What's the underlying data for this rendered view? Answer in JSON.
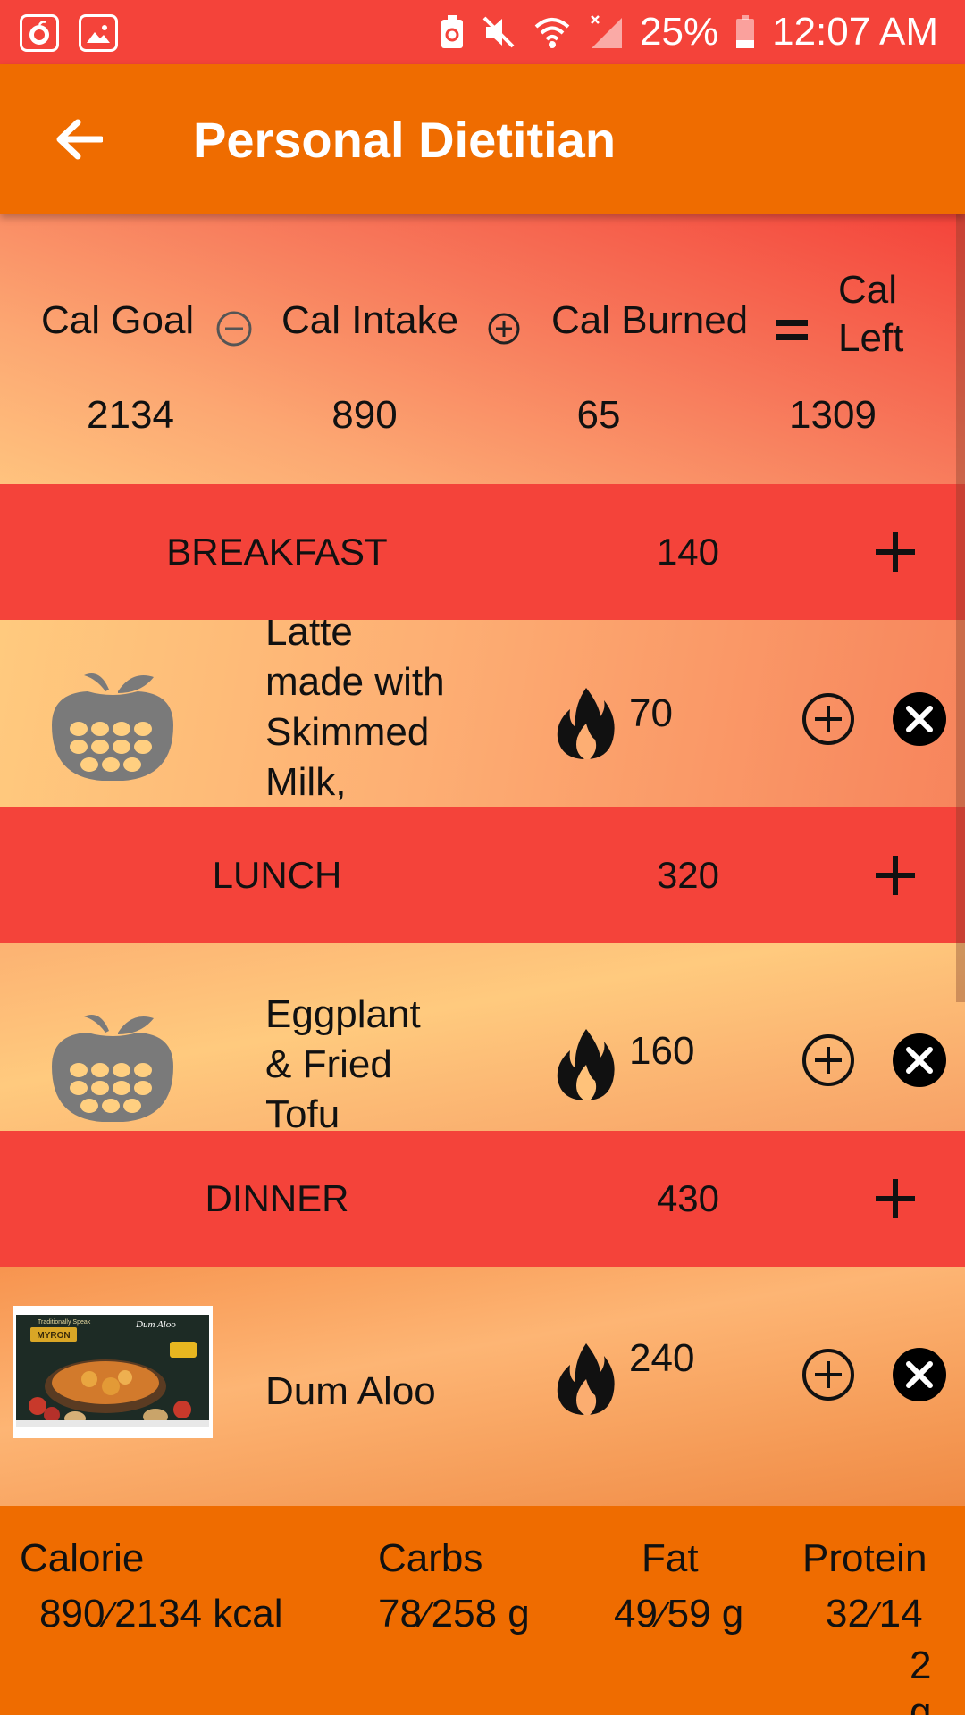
{
  "status_bar": {
    "battery_percent": "25%",
    "time": "12:07 AM",
    "icons": [
      "app-icon",
      "gallery-icon",
      "battery-saver-icon",
      "mute-icon",
      "wifi-icon",
      "signal-icon",
      "battery-icon"
    ]
  },
  "toolbar": {
    "title": "Personal Dietitian",
    "back_icon": "arrow-back-icon"
  },
  "summary": {
    "cal_goal_label": "Cal Goal",
    "cal_intake_label": "Cal Intake",
    "cal_burned_label": "Cal Burned",
    "cal_left_label_line1": "Cal",
    "cal_left_label_line2": "Left",
    "cal_goal": "2134",
    "cal_intake": "890",
    "cal_burned": "65",
    "cal_left": "1309"
  },
  "meals": [
    {
      "name": "BREAKFAST",
      "calories": "140",
      "items": [
        {
          "name_lines": [
            "Latte",
            "made with",
            "Skimmed",
            "Milk,"
          ],
          "calories": "70",
          "image": "calculator-apple-icon"
        }
      ]
    },
    {
      "name": "LUNCH",
      "calories": "320",
      "items": [
        {
          "name_lines": [
            "Eggplant",
            "& Fried",
            "Tofu"
          ],
          "calories": "160",
          "image": "calculator-apple-icon"
        }
      ]
    },
    {
      "name": "DINNER",
      "calories": "430",
      "items": [
        {
          "name_lines": [
            "Dum Aloo"
          ],
          "calories": "240",
          "image": "product-photo",
          "photo_text": {
            "brand": "MYRON",
            "product": "Dum Aloo",
            "tagline": "Traditionally Speak"
          }
        }
      ]
    }
  ],
  "nutrition": {
    "calorie_label": "Calorie",
    "carbs_label": "Carbs",
    "fat_label": "Fat",
    "protein_label": "Protein",
    "calorie_current": "890",
    "calorie_goal": "2134 kcal",
    "carbs_current": "78",
    "carbs_goal": "258 g",
    "fat_current": "49",
    "fat_goal": "59 g",
    "protein_current": "32",
    "protein_goal_line1": "14",
    "protein_goal_line2": "2",
    "protein_goal_line3": "g"
  },
  "colors": {
    "status_bar": "#f4433a",
    "toolbar": "#ef6c00",
    "meal_header": "#f4433a",
    "footer": "#ef6c00"
  }
}
